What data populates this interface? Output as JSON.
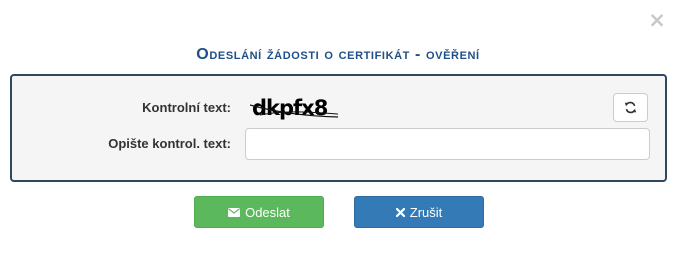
{
  "dialog": {
    "close_symbol": "×",
    "title": "Odeslání žádosti o certifikát - ověření"
  },
  "form": {
    "captcha_label": "Kontrolní text:",
    "captcha_text": "dkpfx8",
    "captcha_input_label": "Opište kontrol. text:",
    "captcha_input_value": "",
    "refresh_icon": "refresh-icon"
  },
  "buttons": {
    "send_label": "Odeslat",
    "send_icon": "envelope-icon",
    "cancel_label": "Zrušit",
    "cancel_icon": "close-icon"
  },
  "colors": {
    "title": "#1f4f86",
    "panel_border": "#2f4862",
    "send_button": "#5cb85c",
    "cancel_button": "#337ab7"
  }
}
